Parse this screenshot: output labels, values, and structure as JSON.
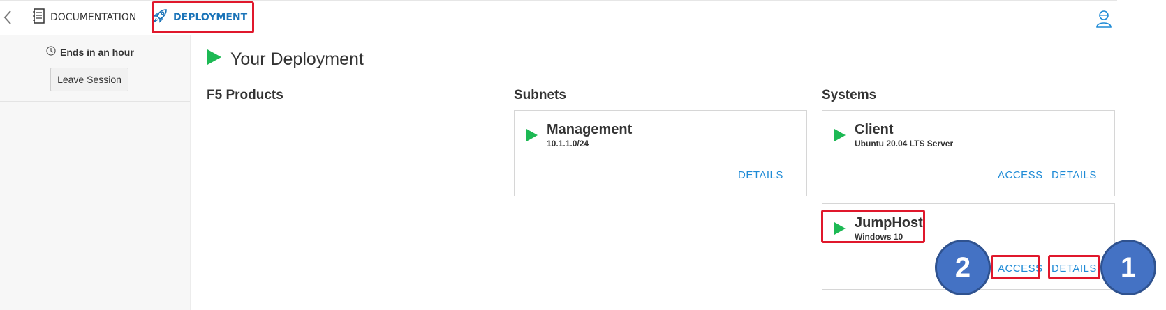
{
  "topbar": {
    "tabs": [
      {
        "label": "DOCUMENTATION",
        "icon": "notebook-icon"
      },
      {
        "label": "DEPLOYMENT",
        "icon": "rocket-icon",
        "active": true
      }
    ],
    "back_icon": "chevron-left-icon",
    "user_icon": "user-icon",
    "active_color": "#1a73b8"
  },
  "sidebar": {
    "timer_text": "Ends in an hour",
    "leave_label": "Leave Session"
  },
  "main": {
    "title": "Your Deployment",
    "columns": {
      "products": "F5 Products",
      "subnets": "Subnets",
      "systems": "Systems"
    },
    "subnets": [
      {
        "name": "Management",
        "cidr": "10.1.1.0/24",
        "details_label": "DETAILS"
      }
    ],
    "systems": [
      {
        "name": "Client",
        "os": "Ubuntu 20.04 LTS Server",
        "access_label": "ACCESS",
        "details_label": "DETAILS"
      },
      {
        "name": "JumpHost",
        "os": "Windows 10",
        "access_label": "ACCESS",
        "details_label": "DETAILS"
      }
    ]
  },
  "callouts": [
    {
      "number": "1"
    },
    {
      "number": "2"
    }
  ],
  "colors": {
    "play_green": "#1db954",
    "link_blue": "#1f8bd6",
    "callout_red": "#e0182c",
    "callout_circle": "#4472c4"
  }
}
